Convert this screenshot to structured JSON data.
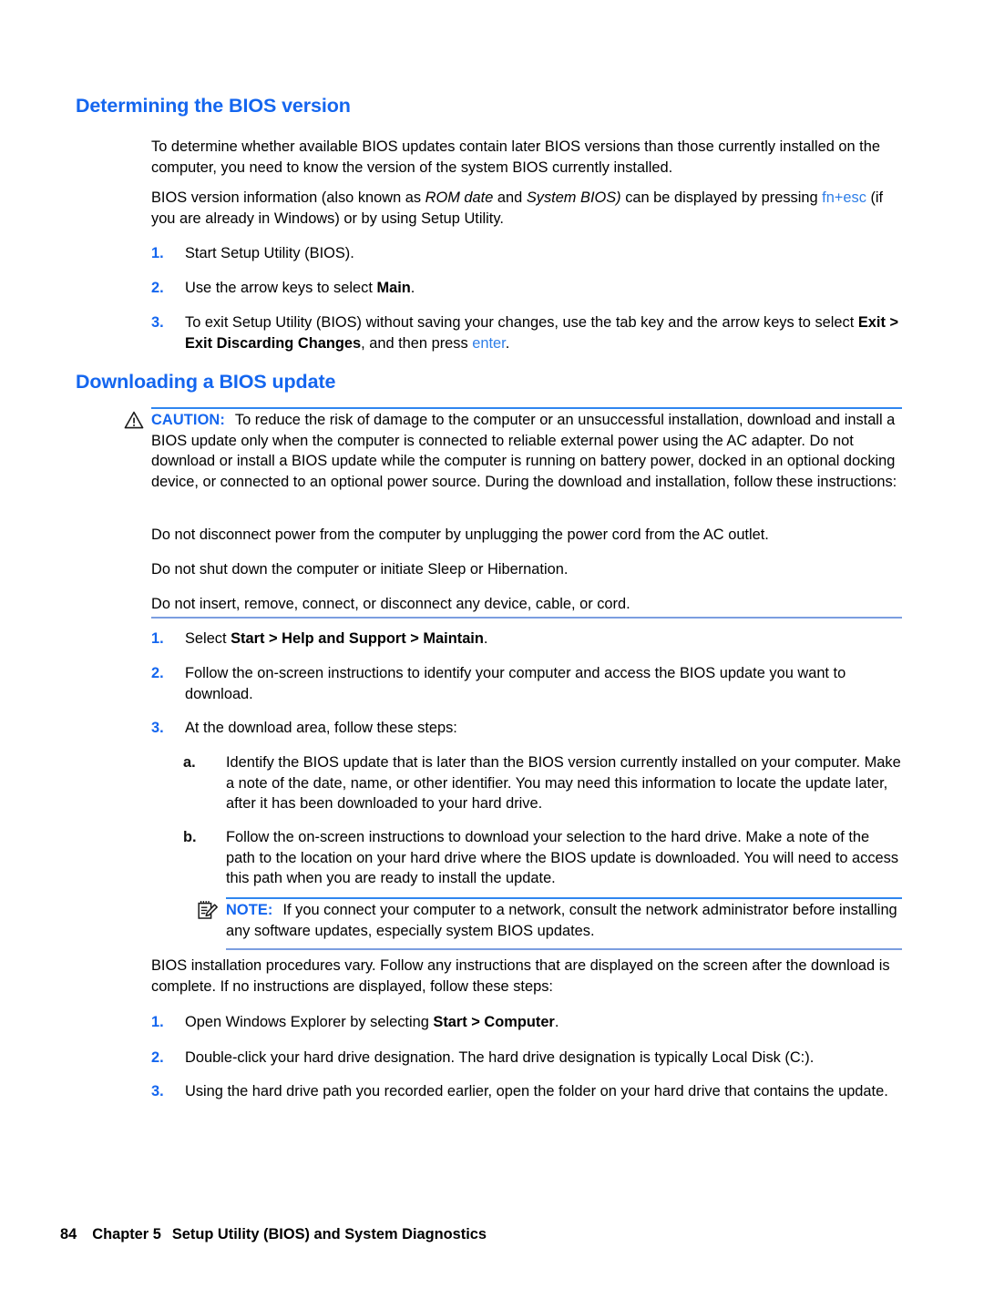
{
  "document": {
    "page_number": "84",
    "chapter": "Chapter 5",
    "chapter_title": "Setup Utility (BIOS) and System Diagnostics"
  },
  "colors": {
    "heading_blue": "#1466ef",
    "link_blue": "#2f7fe8",
    "rule_top_blue": "#2f86f0",
    "rule_bottom_blue": "#7b9ee0",
    "body_black": "#000000"
  },
  "section1": {
    "heading": "Determining the BIOS version",
    "para1": "To determine whether available BIOS updates contain later BIOS versions than those currently installed on the computer, you need to know the version of the system BIOS currently installed.",
    "para2_part1": "BIOS version information (also known as ",
    "para2_italic1": "ROM date",
    "para2_part2": " and ",
    "para2_italic2": "System BIOS)",
    "para2_part3": " can be displayed by pressing ",
    "para2_link": "fn+esc",
    "para2_part4": " (if you are already in Windows) or by using Setup Utility.",
    "steps": [
      {
        "marker": "1.",
        "text_before": "Start Setup Utility (BIOS).",
        "bold": "",
        "text_after": ""
      },
      {
        "marker": "2.",
        "text_before": "Use the arrow keys to select ",
        "bold": "Main",
        "text_after": "."
      },
      {
        "marker": "3.",
        "text_before": "To exit Setup Utility (BIOS) without saving your changes, use the tab key and the arrow keys to select ",
        "bold": "Exit > Exit Discarding Changes",
        "text_mid": ", and then press ",
        "link": "enter",
        "text_after": "."
      }
    ]
  },
  "section2": {
    "heading": "Downloading a BIOS update",
    "caution": {
      "icon": "warning-triangle-icon",
      "label": "CAUTION:",
      "body": "To reduce the risk of damage to the computer or an unsuccessful installation, download and install a BIOS update only when the computer is connected to reliable external power using the AC adapter. Do not download or install a BIOS update while the computer is running on battery power, docked in an optional docking device, or connected to an optional power source. During the download and installation, follow these instructions:",
      "bullets": [
        "Do not disconnect power from the computer by unplugging the power cord from the AC outlet.",
        "Do not shut down the computer or initiate Sleep or Hibernation.",
        "Do not insert, remove, connect, or disconnect any device, cable, or cord."
      ]
    },
    "steps": [
      {
        "marker": "1.",
        "text_before": "Select ",
        "bold": "Start > Help and Support > Maintain",
        "text_after": "."
      },
      {
        "marker": "2.",
        "text_before": "Follow the on-screen instructions to identify your computer and access the BIOS update you want to download.",
        "bold": "",
        "text_after": ""
      },
      {
        "marker": "3.",
        "text_before": "At the download area, follow these steps:",
        "bold": "",
        "text_after": ""
      }
    ],
    "substeps": [
      {
        "marker": "a.",
        "text": "Identify the BIOS update that is later than the BIOS version currently installed on your computer. Make a note of the date, name, or other identifier. You may need this information to locate the update later, after it has been downloaded to your hard drive."
      },
      {
        "marker": "b.",
        "text": "Follow the on-screen instructions to download your selection to the hard drive. Make a note of the path to the location on your hard drive where the BIOS update is downloaded. You will need to access this path when you are ready to install the update."
      }
    ],
    "note": {
      "icon": "notepad-pencil-icon",
      "label": "NOTE:",
      "body": "If you connect your computer to a network, consult the network administrator before installing any software updates, especially system BIOS updates."
    },
    "closing_para": "BIOS installation procedures vary. Follow any instructions that are displayed on the screen after the download is complete. If no instructions are displayed, follow these steps:",
    "final_steps": [
      {
        "marker": "1.",
        "text_before": "Open Windows Explorer by selecting ",
        "bold": "Start > Computer",
        "text_after": "."
      },
      {
        "marker": "2.",
        "text_before": "Double-click your hard drive designation. The hard drive designation is typically Local Disk (C:).",
        "bold": "",
        "text_after": ""
      },
      {
        "marker": "3.",
        "text_before": "Using the hard drive path you recorded earlier, open the folder on your hard drive that contains the update.",
        "bold": "",
        "text_after": ""
      }
    ]
  }
}
